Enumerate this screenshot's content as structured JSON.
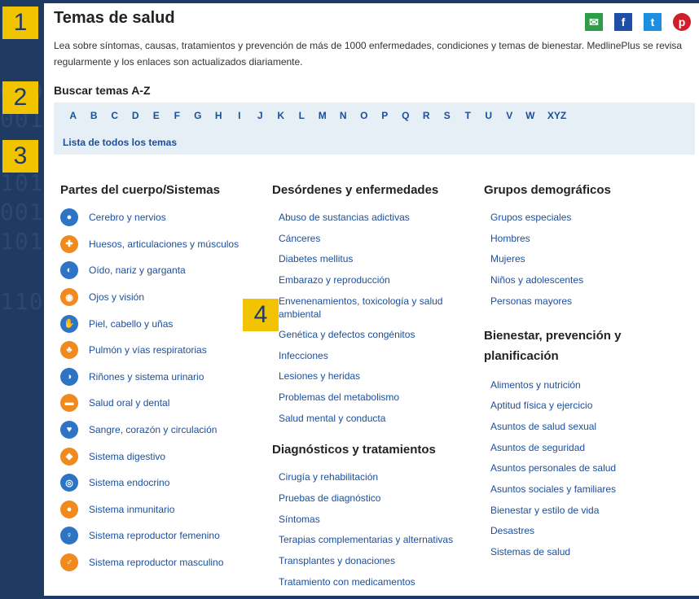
{
  "header": {
    "title": "Temas de salud",
    "intro": "Lea sobre síntomas, causas, tratamientos y prevención de más de 1000 enfermedades, condiciones y temas de bienestar. MedlinePlus se revisa regularmente y los enlaces son actualizados diariamente.",
    "social": [
      "email-icon",
      "facebook-icon",
      "twitter-icon",
      "pinterest-icon"
    ]
  },
  "markers": [
    "1",
    "2",
    "3",
    "4"
  ],
  "az": {
    "title": "Buscar temas A-Z",
    "letters": [
      "A",
      "B",
      "C",
      "D",
      "E",
      "F",
      "G",
      "H",
      "I",
      "J",
      "K",
      "L",
      "M",
      "N",
      "O",
      "P",
      "Q",
      "R",
      "S",
      "T",
      "U",
      "V",
      "W",
      "XYZ"
    ],
    "all_topics": "Lista de todos los temas"
  },
  "body_systems": {
    "title": "Partes del cuerpo/Sistemas",
    "items": [
      {
        "label": "Cerebro y nervios",
        "icon": "brain-icon",
        "color": "blue"
      },
      {
        "label": "Huesos, articulaciones y músculos",
        "icon": "bone-icon",
        "color": "orange"
      },
      {
        "label": "Oído, nariz y garganta",
        "icon": "ear-icon",
        "color": "blue"
      },
      {
        "label": "Ojos y visión",
        "icon": "eye-icon",
        "color": "orange"
      },
      {
        "label": "Piel, cabello y uñas",
        "icon": "hand-icon",
        "color": "blue"
      },
      {
        "label": "Pulmón y vías respiratorias",
        "icon": "lungs-icon",
        "color": "orange"
      },
      {
        "label": "Riñones y sistema urinario",
        "icon": "kidney-icon",
        "color": "blue"
      },
      {
        "label": "Salud oral y dental",
        "icon": "mouth-icon",
        "color": "orange"
      },
      {
        "label": "Sangre, corazón y circulación",
        "icon": "heart-icon",
        "color": "blue"
      },
      {
        "label": "Sistema digestivo",
        "icon": "stomach-icon",
        "color": "orange"
      },
      {
        "label": "Sistema endocrino",
        "icon": "endocrine-icon",
        "color": "blue"
      },
      {
        "label": "Sistema inmunitario",
        "icon": "immune-icon",
        "color": "orange"
      },
      {
        "label": "Sistema reproductor femenino",
        "icon": "female-icon",
        "color": "blue"
      },
      {
        "label": "Sistema reproductor masculino",
        "icon": "male-icon",
        "color": "orange"
      }
    ]
  },
  "disorders": {
    "title": "Desórdenes y enfermedades",
    "items": [
      "Abuso de sustancias adictivas",
      "Cánceres",
      "Diabetes mellitus",
      "Embarazo y reproducción",
      "Envenenamientos, toxicología y salud ambiental",
      "Genética y defectos congénitos",
      "Infecciones",
      "Lesiones y heridas",
      "Problemas del metabolismo",
      "Salud mental y conducta"
    ]
  },
  "diagnostics": {
    "title": "Diagnósticos y tratamientos",
    "items": [
      "Cirugía y rehabilitación",
      "Pruebas de diagnóstico",
      "Síntomas",
      "Terapias complementarias y alternativas",
      "Transplantes y donaciones",
      "Tratamiento con medicamentos"
    ]
  },
  "demographics": {
    "title": "Grupos demográficos",
    "items": [
      "Grupos especiales",
      "Hombres",
      "Mujeres",
      "Niños y adolescentes",
      "Personas mayores"
    ]
  },
  "wellness": {
    "title": "Bienestar, prevención y planificación",
    "items": [
      "Alimentos y nutrición",
      "Aptitud física y ejercicio",
      "Asuntos de salud sexual",
      "Asuntos de seguridad",
      "Asuntos personales de salud",
      "Asuntos sociales y familiares",
      "Bienestar y estilo de vida",
      "Desastres",
      "Sistemas de salud"
    ]
  }
}
